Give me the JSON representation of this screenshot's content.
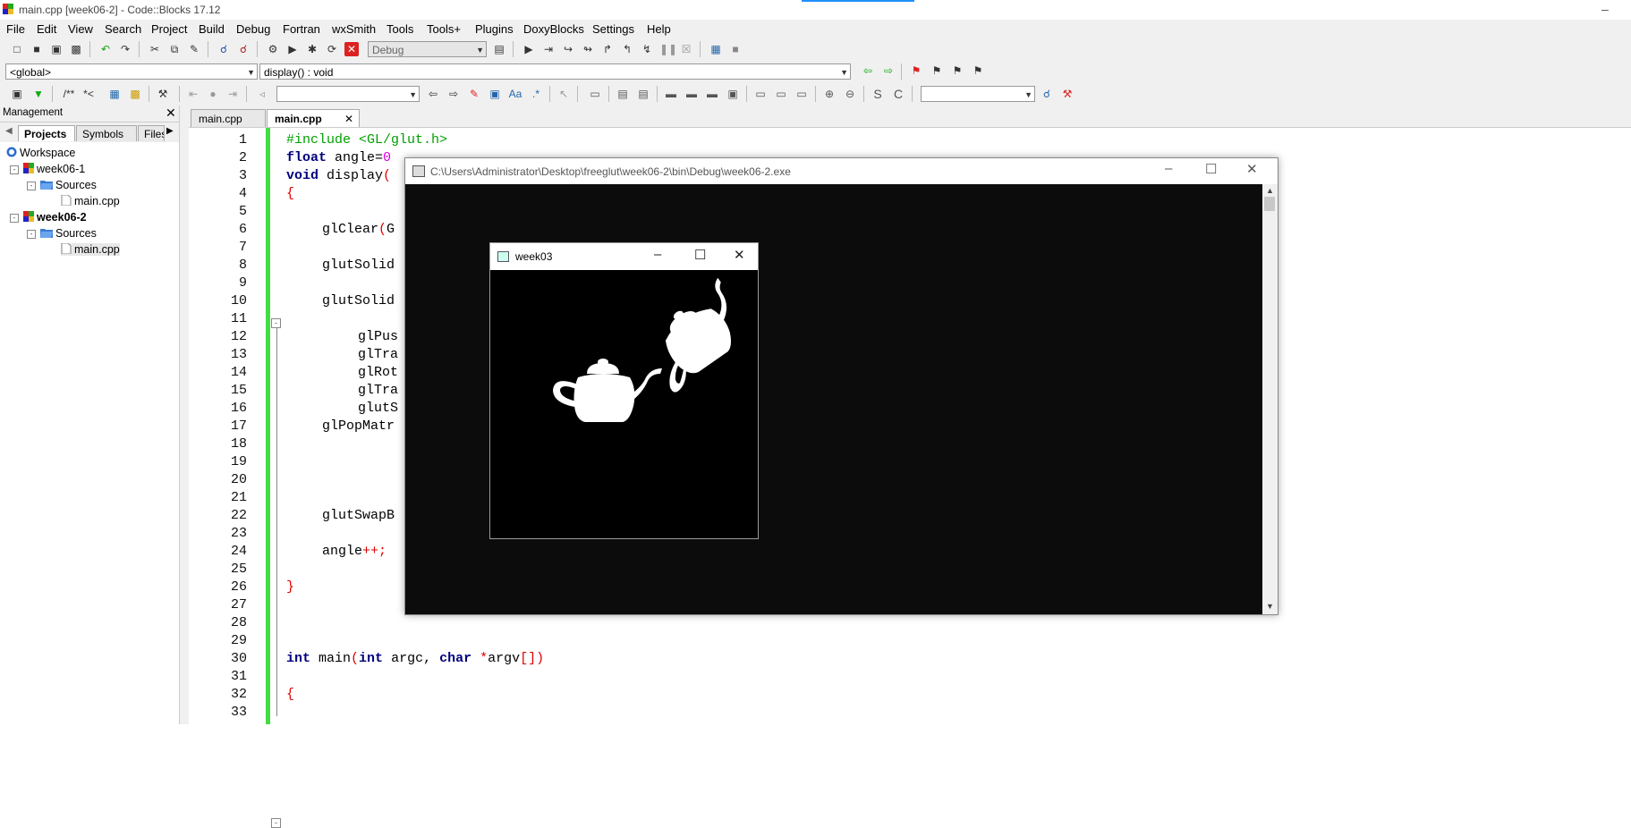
{
  "app": {
    "title": "main.cpp [week06-2] - Code::Blocks 17.12"
  },
  "menu": [
    "File",
    "Edit",
    "View",
    "Search",
    "Project",
    "Build",
    "Debug",
    "Fortran",
    "wxSmith",
    "Tools",
    "Tools+",
    "Plugins",
    "DoxyBlocks",
    "Settings",
    "Help"
  ],
  "toolbar": {
    "build_target": "Debug",
    "scope": "<global>",
    "function": "display() : void",
    "doxy_comment": "/**",
    "doxy_line": "*<"
  },
  "management": {
    "title": "Management",
    "tabs": [
      "Projects",
      "Symbols",
      "Files"
    ],
    "tree": {
      "workspace": "Workspace",
      "projects": [
        {
          "name": "week06-1",
          "folder": "Sources",
          "file": "main.cpp"
        },
        {
          "name": "week06-2",
          "folder": "Sources",
          "file": "main.cpp"
        }
      ]
    }
  },
  "editor": {
    "tabs": [
      "main.cpp",
      "main.cpp"
    ],
    "line_numbers": [
      "1",
      "2",
      "3",
      "4",
      "5",
      "6",
      "7",
      "8",
      "9",
      "10",
      "11",
      "12",
      "13",
      "14",
      "15",
      "16",
      "17",
      "18",
      "19",
      "20",
      "21",
      "22",
      "23",
      "24",
      "25",
      "26",
      "27",
      "28",
      "29",
      "30",
      "31",
      "32",
      "33"
    ],
    "code": {
      "l1_pp": "#include <GL/glut.h>",
      "l2_kw": "float",
      "l2_txt": " angle=",
      "l2_num": "0",
      "l3_kw": "void",
      "l3_txt": " display",
      "l3_op": "(",
      "l4_op": "{",
      "l6_txt": "glClear",
      "l6_op": "(",
      "l6_rest": "G",
      "l8_txt": "glutSolid",
      "l10_txt": "glutSolid",
      "l12_txt": "glPus",
      "l13_txt": "glTra",
      "l14_txt": "glRot",
      "l15_txt": "glTra",
      "l16_txt": "glutS",
      "l17_txt": "glPopMatr",
      "l22_txt": "glutSwapB",
      "l24_txt": "angle",
      "l24_op": "++;",
      "l26_op": "}",
      "l30_kw1": "int",
      "l30_txt1": " main",
      "l30_op1": "(",
      "l30_kw2": "int",
      "l30_txt2": " argc, ",
      "l30_kw3": "char",
      "l30_txt3": " ",
      "l30_op2": "*",
      "l30_txt4": "argv",
      "l30_op3": "[])",
      "l32_op": "{"
    }
  },
  "console": {
    "title": "C:\\Users\\Administrator\\Desktop\\freeglut\\week06-2\\bin\\Debug\\week06-2.exe"
  },
  "glwindow": {
    "title": "week03"
  },
  "window_controls": {
    "minimize": "–",
    "maximize": "☐",
    "close": "✕"
  },
  "colors": {
    "change_bar": "#44dd44",
    "keyword": "#00007f",
    "preprocessor": "#00a000",
    "operator": "#e00000",
    "number": "#e000e0"
  }
}
